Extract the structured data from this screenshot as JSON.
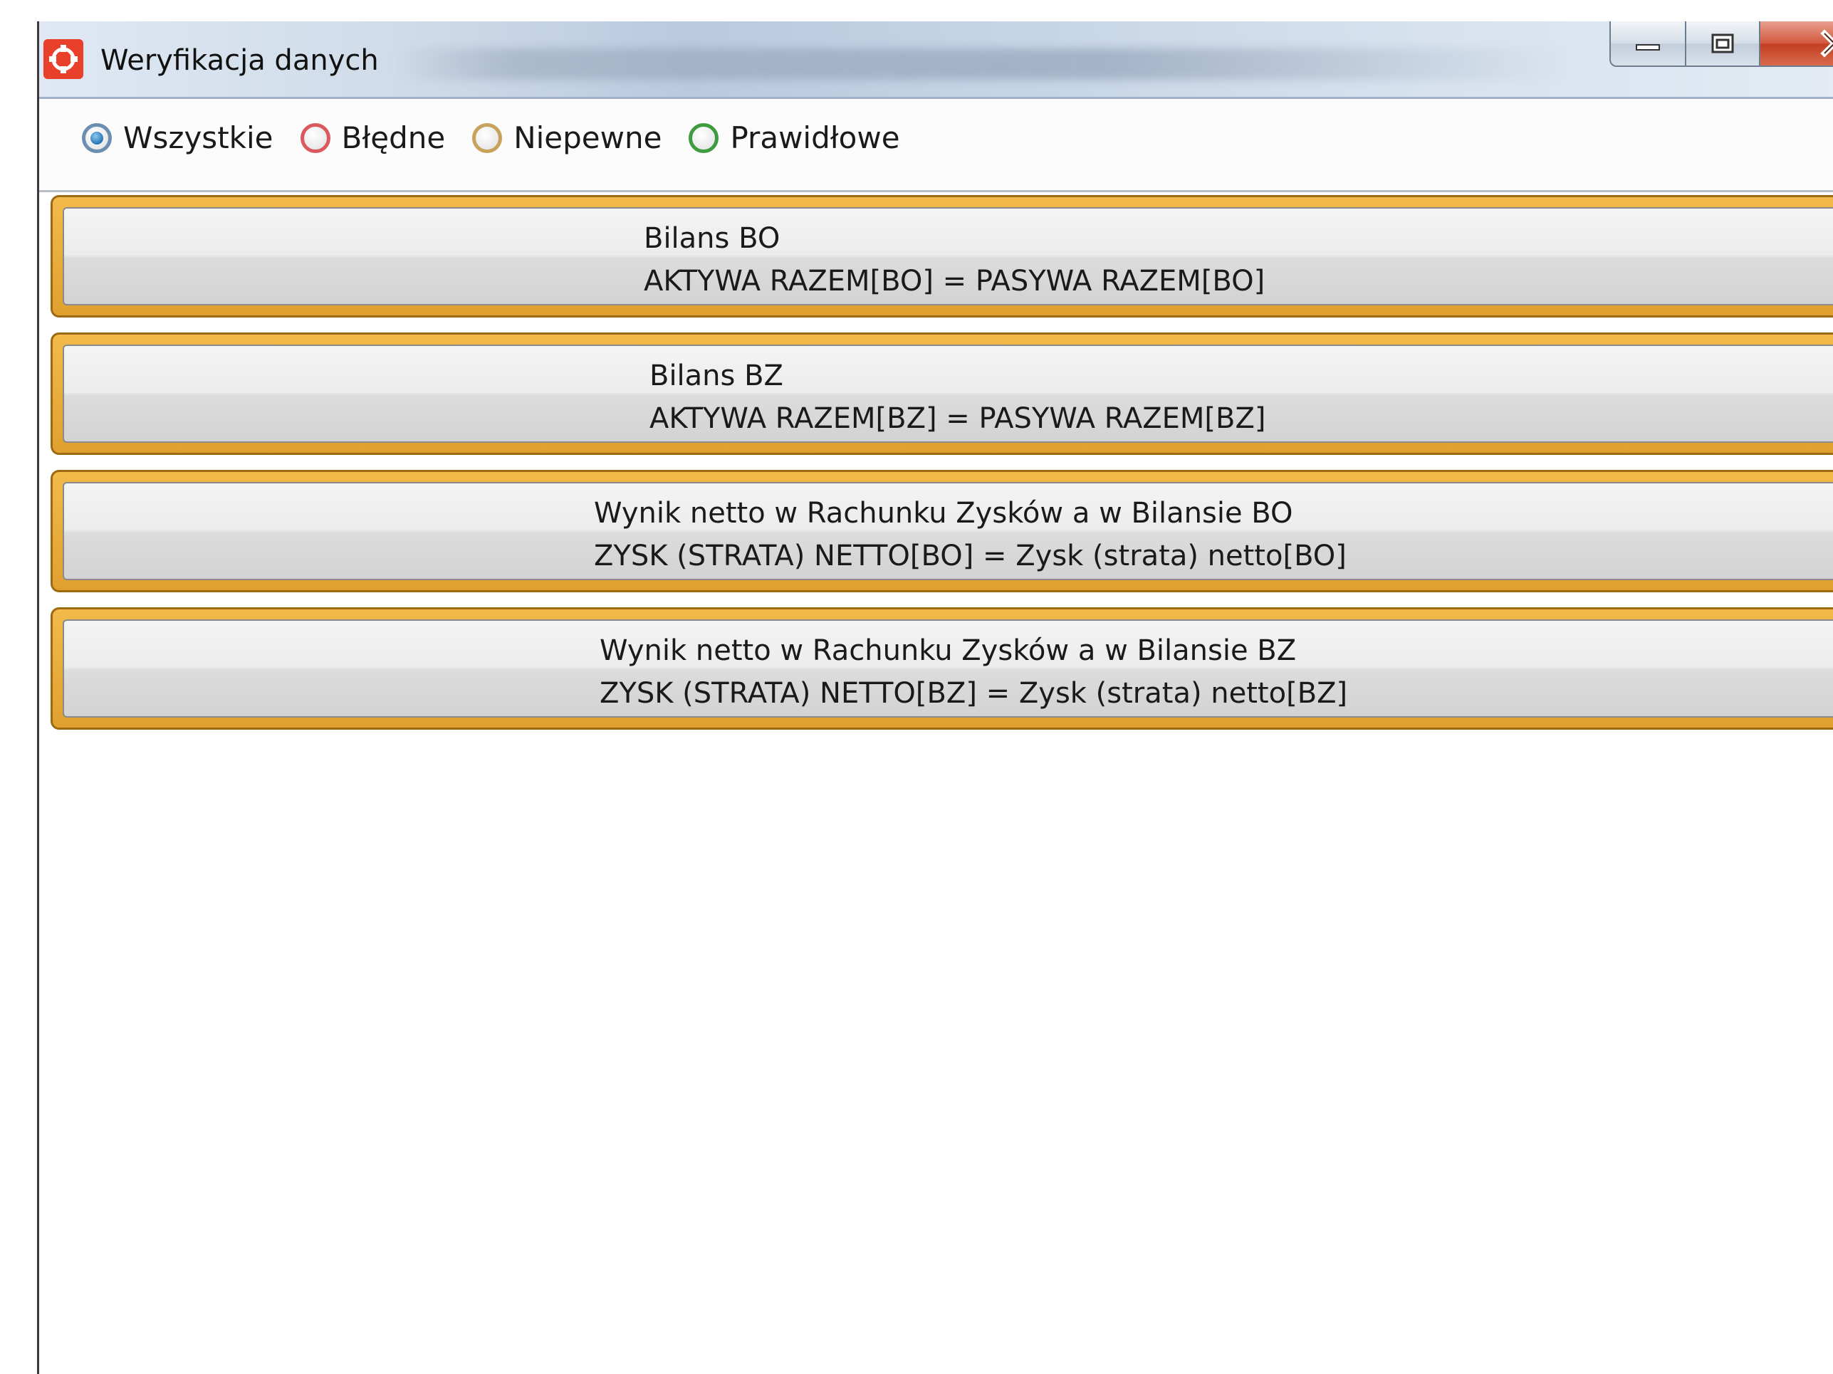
{
  "window": {
    "title": "Weryfikacja danych",
    "icon": "app-logo-icon"
  },
  "caption_buttons": {
    "minimize": "minimize-icon",
    "maximize": "maximize-icon",
    "close": "close-icon"
  },
  "filter": {
    "selected": "Wszystkie",
    "options": [
      {
        "label": "Wszystkie",
        "color": "#1d6fb1"
      },
      {
        "label": "Błędne",
        "color": "#d9595f"
      },
      {
        "label": "Niepewne",
        "color": "#c8a25a"
      },
      {
        "label": "Prawidłowe",
        "color": "#3f9b3f"
      }
    ]
  },
  "items": [
    {
      "title": "Bilans BO",
      "rule": "AKTYWA RAZEM[BO] = PASYWA RAZEM[BO]",
      "status_color": "#e8a93a"
    },
    {
      "title": "Bilans BZ",
      "rule": "AKTYWA RAZEM[BZ] = PASYWA RAZEM[BZ]",
      "status_color": "#e8a93a"
    },
    {
      "title": "Wynik netto w Rachunku Zysków a w Bilansie BO",
      "rule": "ZYSK (STRATA) NETTO[BO] = Zysk (strata) netto[BO]",
      "status_color": "#e8a93a"
    },
    {
      "title": "Wynik netto w Rachunku Zysków a w Bilansie BZ",
      "rule": "ZYSK (STRATA) NETTO[BZ] = Zysk (strata) netto[BZ]",
      "status_color": "#e8a93a"
    }
  ]
}
